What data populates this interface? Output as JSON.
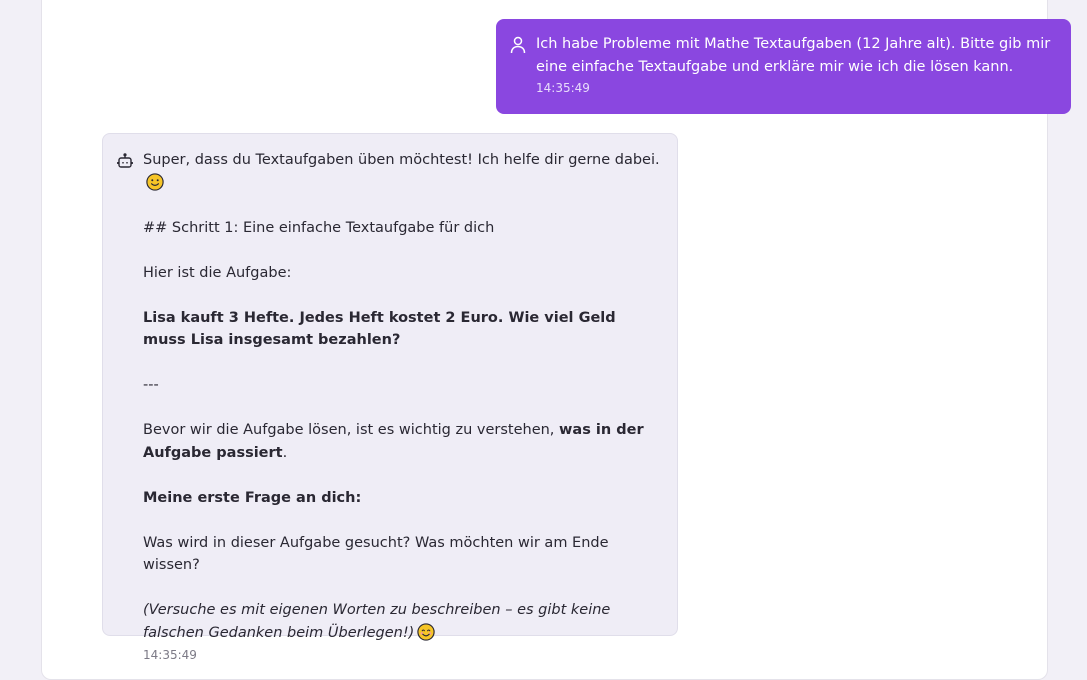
{
  "colors": {
    "user_bubble": "#8a47e0",
    "bot_bubble": "#efedf6",
    "page_bg": "#f2f0f7"
  },
  "messages": {
    "user": {
      "icon": "user-icon",
      "text": "Ich habe Probleme mit Mathe Textaufgaben (12 Jahre alt). Bitte gib mir eine einfache Textaufgabe und erkläre mir wie ich die lösen kann.",
      "time": "14:35:49"
    },
    "bot": {
      "icon": "bot-icon",
      "greeting": "Super, dass du Textaufgaben üben möchtest! Ich helfe dir gerne dabei.",
      "greeting_emoji": "slightly-smiling-face",
      "heading": "## Schritt 1: Eine einfache Textaufgabe für dich",
      "intro": "Hier ist die Aufgabe:",
      "task": "Lisa kauft 3 Hefte. Jedes Heft kostet 2 Euro. Wie viel Geld muss Lisa insgesamt bezahlen?",
      "separator": "---",
      "explain_start": "Bevor wir die Aufgabe lösen, ist es wichtig zu verstehen, ",
      "explain_bold": "was in der Aufgabe passiert",
      "explain_end": ".",
      "question_heading": "Meine erste Frage an dich:",
      "question": "Was wird in dieser Aufgabe gesucht? Was möchten wir am Ende wissen?",
      "hint": "(Versuche es mit eigenen Worten zu beschreiben – es gibt keine falschen Gedanken beim Überlegen!)",
      "hint_emoji": "smiling-face-with-smiling-eyes",
      "time": "14:35:49"
    }
  }
}
